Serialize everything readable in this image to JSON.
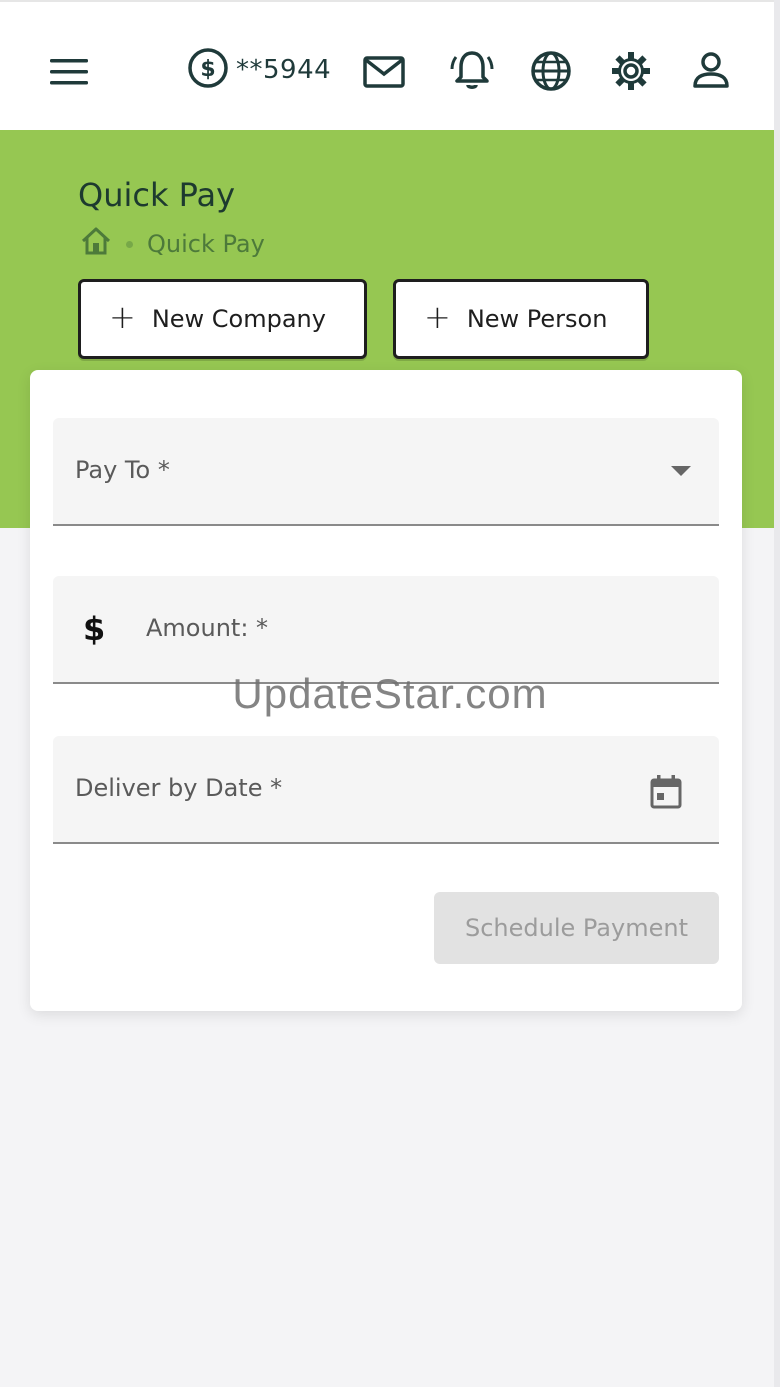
{
  "header": {
    "menu_icon": "menu-icon",
    "account": {
      "icon": "dollar-circle-icon",
      "number": "**5944"
    },
    "icons": [
      "mail-icon",
      "bell-ringing-icon",
      "globe-icon",
      "gear-icon",
      "user-icon"
    ]
  },
  "page": {
    "title": "Quick Pay",
    "breadcrumb": {
      "home_icon": "home-icon",
      "current": "Quick Pay"
    },
    "buttons": {
      "new_company": "New Company",
      "new_person": "New Person"
    }
  },
  "form": {
    "pay_to_label": "Pay To *",
    "amount_prefix": "$",
    "amount_label": "Amount: *",
    "deliver_date_label": "Deliver by Date *",
    "schedule_button": "Schedule Payment"
  },
  "watermark": "UpdateStar.com",
  "colors": {
    "brand_green": "#96c752",
    "dark_text": "#1f3a3a",
    "disabled_button": "#e2e2e2"
  }
}
